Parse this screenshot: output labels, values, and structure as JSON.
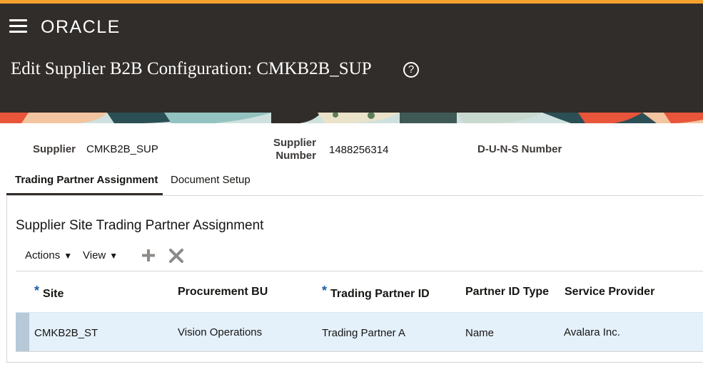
{
  "app": {
    "logo_text": "ORACLE",
    "accent_color": "#f7a12f",
    "header_color": "#312d2a"
  },
  "page": {
    "title": "Edit Supplier B2B Configuration: CMKB2B_SUP",
    "help_icon": "?"
  },
  "fields": {
    "supplier_label": "Supplier",
    "supplier_value": "CMKB2B_SUP",
    "supplier_number_label_line1": "Supplier",
    "supplier_number_label_line2": "Number",
    "supplier_number_value": "1488256314",
    "duns_label": "D-U-N-S Number"
  },
  "tabs": [
    {
      "label": "Trading Partner Assignment",
      "active": true
    },
    {
      "label": "Document Setup",
      "active": false
    }
  ],
  "section": {
    "title": "Supplier Site Trading Partner Assignment"
  },
  "toolbar": {
    "actions_label": "Actions",
    "view_label": "View",
    "add_icon": "plus-icon",
    "delete_icon": "x-icon"
  },
  "table": {
    "columns": [
      {
        "label": "Site",
        "required": true
      },
      {
        "label": "Procurement BU",
        "required": false
      },
      {
        "label": "Trading Partner ID",
        "required": true
      },
      {
        "label": "Partner ID Type",
        "required": false
      },
      {
        "label": "Service Provider",
        "required": false
      }
    ],
    "required_marker": "*",
    "rows": [
      {
        "site": "CMKB2B_ST",
        "bu": "Vision Operations",
        "tp_id": "Trading Partner A",
        "id_type": "Name",
        "provider": "Avalara Inc."
      }
    ]
  }
}
